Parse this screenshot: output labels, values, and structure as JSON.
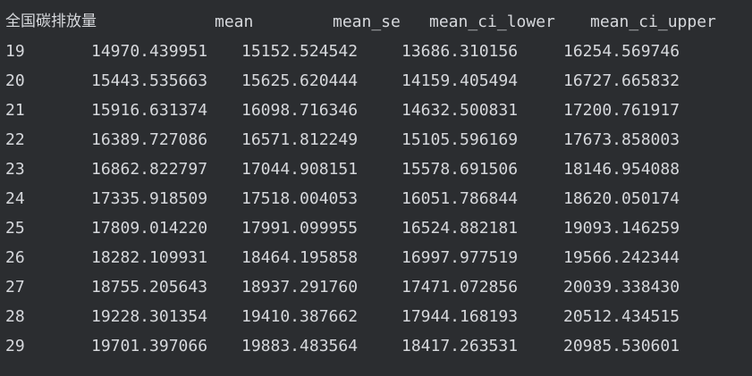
{
  "table": {
    "headers": [
      "全国碳排放量",
      "mean",
      "mean_se",
      "mean_ci_lower",
      "mean_ci_upper"
    ],
    "rows": [
      [
        "19",
        "14970.439951",
        "15152.524542",
        "13686.310156",
        "16254.569746"
      ],
      [
        "20",
        "15443.535663",
        "15625.620444",
        "14159.405494",
        "16727.665832"
      ],
      [
        "21",
        "15916.631374",
        "16098.716346",
        "14632.500831",
        "17200.761917"
      ],
      [
        "22",
        "16389.727086",
        "16571.812249",
        "15105.596169",
        "17673.858003"
      ],
      [
        "23",
        "16862.822797",
        "17044.908151",
        "15578.691506",
        "18146.954088"
      ],
      [
        "24",
        "17335.918509",
        "17518.004053",
        "16051.786844",
        "18620.050174"
      ],
      [
        "25",
        "17809.014220",
        "17991.099955",
        "16524.882181",
        "19093.146259"
      ],
      [
        "26",
        "18282.109931",
        "18464.195858",
        "16997.977519",
        "19566.242344"
      ],
      [
        "27",
        "18755.205643",
        "18937.291760",
        "17471.072856",
        "20039.338430"
      ],
      [
        "28",
        "19228.301354",
        "19410.387662",
        "17944.168193",
        "20512.434515"
      ],
      [
        "29",
        "19701.397066",
        "19883.483564",
        "18417.263531",
        "20985.530601"
      ]
    ]
  }
}
